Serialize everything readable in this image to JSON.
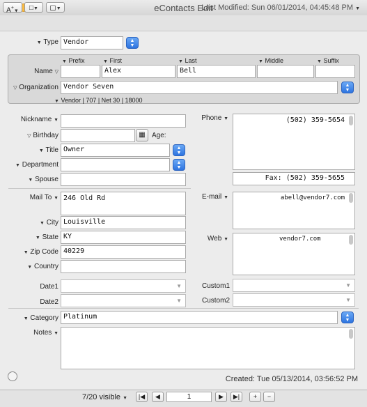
{
  "window": {
    "title": "eContacts Edit"
  },
  "toolbar": {
    "font_button": "A",
    "layout_button": "□",
    "notes_button": "▢",
    "last_modified": "Last Modified: Sun 06/01/2014, 04:45:48 PM"
  },
  "type": {
    "label": "Type",
    "value": "Vendor"
  },
  "name": {
    "label": "Name",
    "headers": {
      "prefix": "Prefix",
      "first": "First",
      "last": "Last",
      "middle": "Middle",
      "suffix": "Suffix"
    },
    "values": {
      "prefix": "",
      "first": "Alex",
      "last": "Bell",
      "middle": "",
      "suffix": ""
    }
  },
  "organization": {
    "label": "Organization",
    "value": "Vendor Seven",
    "sub": "Vendor | 707 | Net 30 | 18000"
  },
  "left": {
    "nickname": {
      "label": "Nickname",
      "value": ""
    },
    "birthday": {
      "label": "Birthday",
      "value": "",
      "age_label": "Age:"
    },
    "title": {
      "label": "Title",
      "value": "Owner"
    },
    "department": {
      "label": "Department",
      "value": ""
    },
    "spouse": {
      "label": "Spouse",
      "value": ""
    },
    "mail_to": {
      "label": "Mail To",
      "value": "246 Old Rd"
    },
    "city": {
      "label": "City",
      "value": "Louisville"
    },
    "state": {
      "label": "State",
      "value": "KY"
    },
    "zip": {
      "label": "Zip Code",
      "value": "40229"
    },
    "country": {
      "label": "Country",
      "value": ""
    },
    "date1": {
      "label": "Date1",
      "value": ""
    },
    "date2": {
      "label": "Date2",
      "value": ""
    }
  },
  "right": {
    "phone": {
      "label": "Phone",
      "value": "(502) 359-5654",
      "fax": "Fax: (502) 359-5655"
    },
    "email": {
      "label": "E-mail",
      "value": "abell@vendor7.com"
    },
    "web": {
      "label": "Web",
      "value": "vendor7.com"
    },
    "custom1": {
      "label": "Custom1",
      "value": ""
    },
    "custom2": {
      "label": "Custom2",
      "value": ""
    }
  },
  "category": {
    "label": "Category",
    "value": "Platinum"
  },
  "notes": {
    "label": "Notes",
    "value": ""
  },
  "created": "Created: Tue 05/13/2014, 03:56:52 PM",
  "footer": {
    "visible": "7/20 visible",
    "page": "1"
  },
  "colors": {
    "accent": "#2e74e0",
    "close": "#fc605c",
    "minimize": "#fdbc40",
    "zoom": "#34c84a"
  }
}
